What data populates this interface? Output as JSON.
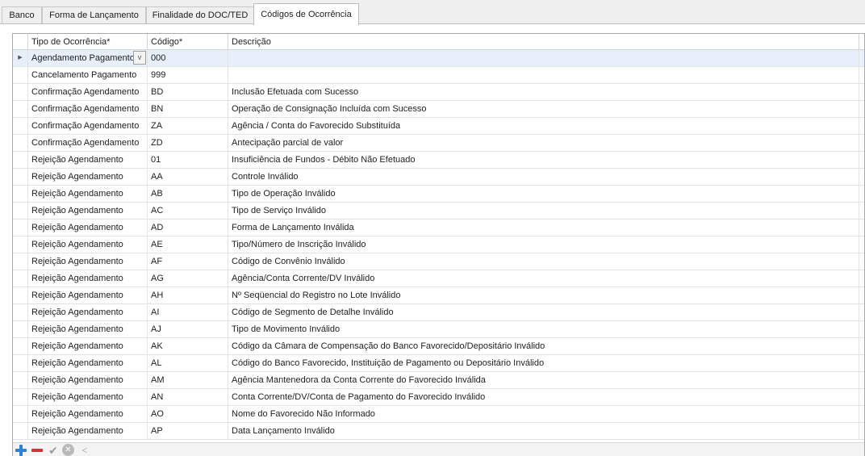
{
  "tabs": [
    {
      "label": "Banco"
    },
    {
      "label": "Forma de Lançamento"
    },
    {
      "label": "Finalidade do DOC/TED"
    },
    {
      "label": "Códigos de Ocorrência"
    }
  ],
  "active_tab": "Códigos de Ocorrência",
  "grid": {
    "columns": [
      "Tipo de Ocorrência*",
      "Código*",
      "Descrição"
    ],
    "rows": [
      {
        "tipo": "Agendamento Pagamento",
        "codigo": "000",
        "descricao": ""
      },
      {
        "tipo": "Cancelamento Pagamento",
        "codigo": "999",
        "descricao": ""
      },
      {
        "tipo": "Confirmação Agendamento",
        "codigo": "BD",
        "descricao": "Inclusão Efetuada com Sucesso"
      },
      {
        "tipo": "Confirmação Agendamento",
        "codigo": "BN",
        "descricao": "Operação de Consignação Incluída com Sucesso"
      },
      {
        "tipo": "Confirmação Agendamento",
        "codigo": "ZA",
        "descricao": "Agência / Conta do Favorecido Substituída"
      },
      {
        "tipo": "Confirmação Agendamento",
        "codigo": "ZD",
        "descricao": "Antecipação parcial de valor"
      },
      {
        "tipo": "Rejeição Agendamento",
        "codigo": "01",
        "descricao": "Insuficiência de Fundos - Débito Não Efetuado"
      },
      {
        "tipo": "Rejeição Agendamento",
        "codigo": "AA",
        "descricao": "Controle Inválido"
      },
      {
        "tipo": "Rejeição Agendamento",
        "codigo": "AB",
        "descricao": "Tipo de Operação Inválido"
      },
      {
        "tipo": "Rejeição Agendamento",
        "codigo": "AC",
        "descricao": "Tipo de Serviço Inválido"
      },
      {
        "tipo": "Rejeição Agendamento",
        "codigo": "AD",
        "descricao": "Forma de Lançamento Inválida"
      },
      {
        "tipo": "Rejeição Agendamento",
        "codigo": "AE",
        "descricao": "Tipo/Número de Inscrição Inválido"
      },
      {
        "tipo": "Rejeição Agendamento",
        "codigo": "AF",
        "descricao": "Código de Convênio Inválido"
      },
      {
        "tipo": "Rejeição Agendamento",
        "codigo": "AG",
        "descricao": "Agência/Conta Corrente/DV Inválido"
      },
      {
        "tipo": "Rejeição Agendamento",
        "codigo": "AH",
        "descricao": "Nº Seqüencial do Registro no Lote Inválido"
      },
      {
        "tipo": "Rejeição Agendamento",
        "codigo": "AI",
        "descricao": "Código de Segmento de Detalhe Inválido"
      },
      {
        "tipo": "Rejeição Agendamento",
        "codigo": "AJ",
        "descricao": "Tipo de Movimento Inválido"
      },
      {
        "tipo": "Rejeição Agendamento",
        "codigo": "AK",
        "descricao": "Código da Câmara de Compensação do Banco Favorecido/Depositário Inválido"
      },
      {
        "tipo": "Rejeição Agendamento",
        "codigo": "AL",
        "descricao": "Código do Banco Favorecido, Instituição de Pagamento ou Depositário Inválido"
      },
      {
        "tipo": "Rejeição Agendamento",
        "codigo": "AM",
        "descricao": "Agência Mantenedora da Conta Corrente do Favorecido Inválida"
      },
      {
        "tipo": "Rejeição Agendamento",
        "codigo": "AN",
        "descricao": "Conta Corrente/DV/Conta de Pagamento do Favorecido Inválido"
      },
      {
        "tipo": "Rejeição Agendamento",
        "codigo": "AO",
        "descricao": "Nome do Favorecido Não Informado"
      },
      {
        "tipo": "Rejeição Agendamento",
        "codigo": "AP",
        "descricao": "Data Lançamento Inválido"
      }
    ],
    "selected_row": 0,
    "row_selector_glyph": "▶",
    "combo_glyph": "v"
  },
  "toolbar": {
    "icons": [
      "add-icon",
      "remove-icon",
      "confirm-icon",
      "cancel-icon",
      "previous-icon"
    ],
    "confirm_glyph": "✔",
    "cancel_glyph": "✕",
    "prev_glyph": "<"
  },
  "colors": {
    "selected_row": "#e7f0fa",
    "add": "#2f7fd6",
    "remove": "#d43333"
  }
}
